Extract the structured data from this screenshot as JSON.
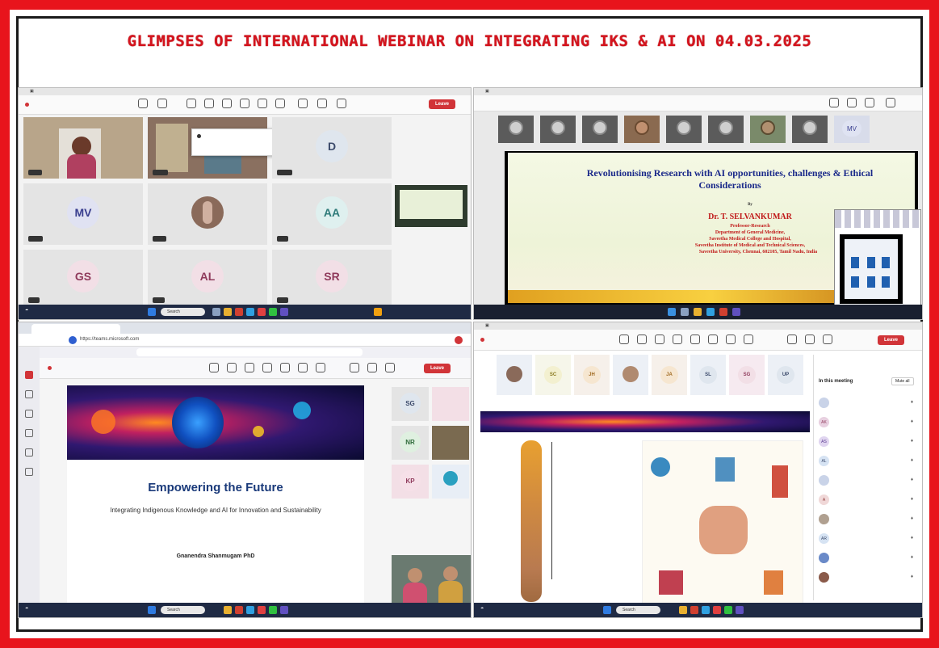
{
  "title": "GLIMPSES OF INTERNATIONAL WEBINAR ON INTEGRATING IKS & AI ON 04.03.2025",
  "colors": {
    "frame": "#e8141c",
    "title": "#d4141e",
    "teams_leave": "#d13438",
    "slide_title": "#1b2a8a"
  },
  "q1": {
    "leave_label": "Leave",
    "tiles": [
      {
        "initials": "D",
        "bg": "#dfe6ee",
        "fg": "#3b4a6b"
      },
      {
        "initials": "MV",
        "bg": "#e0e2f2",
        "fg": "#3a3f8f"
      },
      {
        "initials": "AA",
        "bg": "#dff0ef",
        "fg": "#2f7b7a"
      },
      {
        "initials": "GS",
        "bg": "#f2dfe6",
        "fg": "#8f3a5b"
      },
      {
        "initials": "AL",
        "bg": "#f2dfe6",
        "fg": "#8f3a5b"
      },
      {
        "initials": "SR",
        "bg": "#f2dfe6",
        "fg": "#8f3a5b"
      }
    ],
    "search_label": "Search"
  },
  "q2": {
    "thumb_initials": "MV",
    "slide_title": "Revolutionising Research with AI opportunities, challenges & Ethical Considerations",
    "by": "By",
    "speaker": "Dr. T. SELVANKUMAR",
    "lines": [
      "Professor-Research",
      "Department of General Medicine,",
      "Saveetha Medical College and Hospital,",
      "Saveetha Institute of Medical and Technical Sciences,",
      "Saveetha University, Chennai, 602105, Tamil Nadu, India"
    ]
  },
  "q3": {
    "leave_label": "Leave",
    "url": "https://teams.microsoft.com",
    "slide_title": "Empowering the Future",
    "slide_subtitle": "Integrating Indigenous Knowledge and AI for Innovation and Sustainability",
    "presenter": "Gnanendra Shanmugam PhD",
    "side_tiles": [
      "SG",
      "NR",
      "KP"
    ],
    "search_label": "Search"
  },
  "q4": {
    "leave_label": "Leave",
    "top_initials": [
      "SC",
      "JH",
      "JA",
      "SL",
      "SG",
      "UP"
    ],
    "panel_title": "In this meeting",
    "mute_all": "Mute all",
    "search_label": "Search",
    "people": [
      {
        "initials": "",
        "bg": "#c9d3e8"
      },
      {
        "initials": "AK",
        "bg": "#e8d0e0"
      },
      {
        "initials": "AS",
        "bg": "#e0d5f0"
      },
      {
        "initials": "AL",
        "bg": "#d6e3f3"
      },
      {
        "initials": "",
        "bg": "#c9d3e8"
      },
      {
        "initials": "A",
        "bg": "#f0d8d8"
      },
      {
        "initials": "",
        "bg": "#b0a090"
      },
      {
        "initials": "AR",
        "bg": "#d6e3f3"
      },
      {
        "initials": "",
        "bg": "#6a8ac8"
      },
      {
        "initials": "",
        "bg": "#8a5a4a"
      }
    ]
  }
}
